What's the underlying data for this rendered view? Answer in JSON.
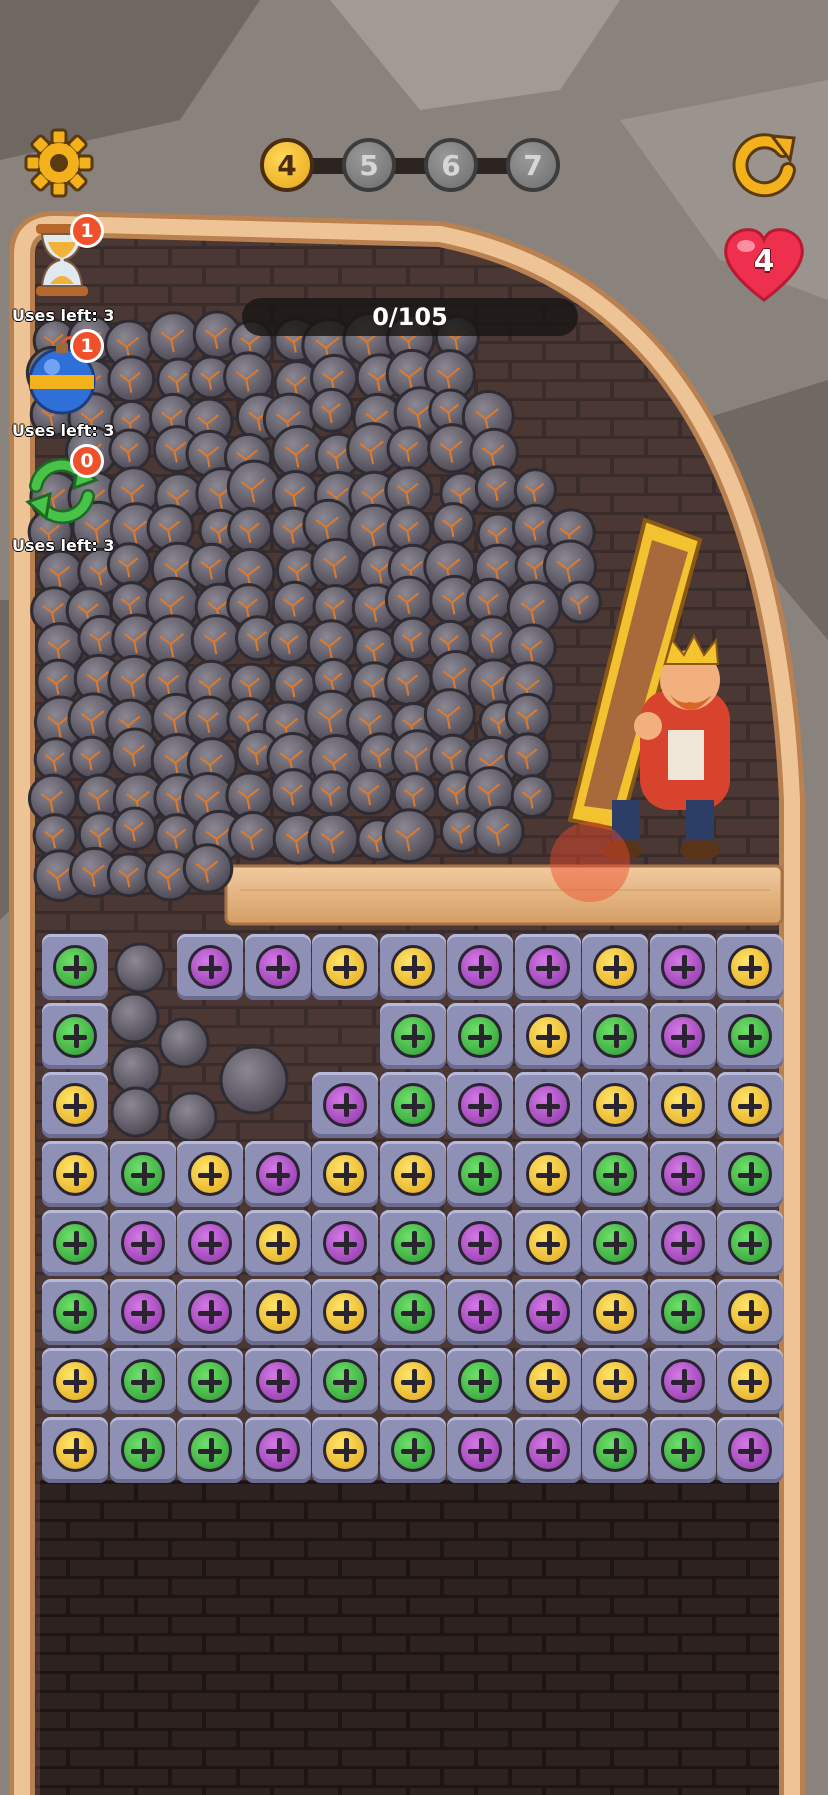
{
  "hud": {
    "current_level": "4",
    "next_levels": [
      "5",
      "6",
      "7"
    ],
    "lives": "4",
    "progress": "0/105"
  },
  "boosters": [
    {
      "icon": "hourglass-icon",
      "badge": "1",
      "uses": "Uses left: 3"
    },
    {
      "icon": "bomb-icon",
      "badge": "1",
      "uses": "Uses left: 3"
    },
    {
      "icon": "shuffle-icon",
      "badge": "0",
      "uses": "Uses left: 3"
    }
  ],
  "board": {
    "columns": 11,
    "rows": [
      [
        "green",
        null,
        "purple",
        "purple",
        "yellow",
        "yellow",
        "purple",
        "purple",
        "yellow",
        "purple",
        "yellow"
      ],
      [
        "green",
        null,
        null,
        null,
        null,
        "green",
        "green",
        "yellow",
        "green",
        "purple",
        "green"
      ],
      [
        "yellow",
        null,
        null,
        null,
        "purple",
        "green",
        "purple",
        "purple",
        "yellow",
        "yellow",
        "yellow"
      ],
      [
        "yellow",
        "green",
        "yellow",
        "purple",
        "yellow",
        "yellow",
        "green",
        "yellow",
        "green",
        "purple",
        "green"
      ],
      [
        "green",
        "purple",
        "purple",
        "yellow",
        "purple",
        "green",
        "purple",
        "yellow",
        "green",
        "purple",
        "green"
      ],
      [
        "green",
        "purple",
        "purple",
        "yellow",
        "yellow",
        "green",
        "purple",
        "purple",
        "yellow",
        "green",
        "yellow"
      ],
      [
        "yellow",
        "green",
        "green",
        "purple",
        "green",
        "yellow",
        "green",
        "yellow",
        "yellow",
        "purple",
        "yellow"
      ],
      [
        "yellow",
        "green",
        "green",
        "purple",
        "yellow",
        "green",
        "purple",
        "purple",
        "green",
        "green",
        "purple"
      ]
    ]
  },
  "colors": {
    "green": "#3cb843",
    "purple": "#a94ec4",
    "yellow": "#f2c630",
    "tile": "#8e90b6",
    "wood": "#e6b77e",
    "wall_dark": "#2a1f1e"
  }
}
